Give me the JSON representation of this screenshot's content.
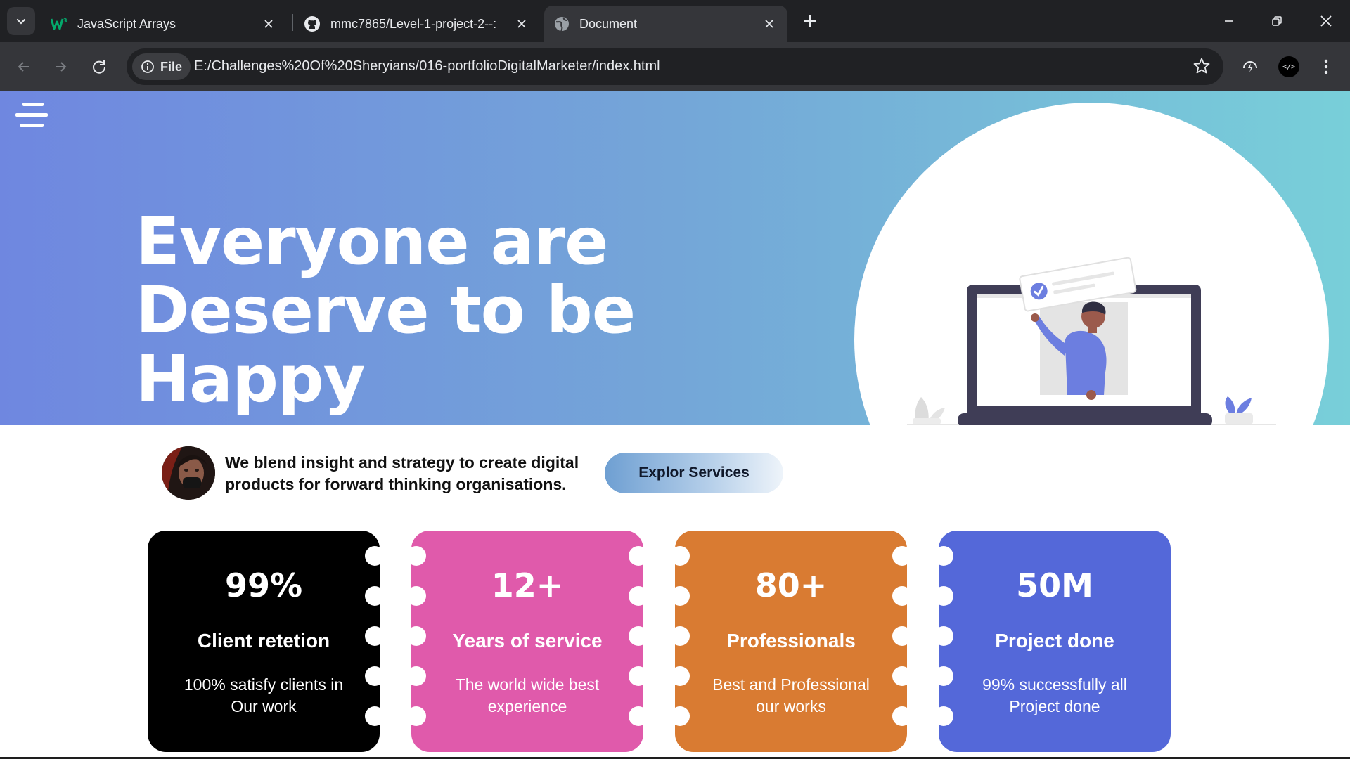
{
  "browser": {
    "tabs": [
      {
        "title": "JavaScript Arrays",
        "icon": "w3schools-icon",
        "active": false
      },
      {
        "title": "mmc7865/Level-1-project-2--:",
        "icon": "github-icon",
        "active": false
      },
      {
        "title": "Document",
        "icon": "globe-icon",
        "active": true
      }
    ],
    "omnibox": {
      "chip_label": "File",
      "url": "E:/Challenges%20Of%20Sheryians/016-portfolioDigitalMarketer/index.html"
    }
  },
  "page": {
    "hero": {
      "title_line1": "Everyone are",
      "title_line2": "Deserve to be",
      "title_line3": "Happy"
    },
    "intro": {
      "text": "We blend insight and strategy to create digital products for forward thinking organisations.",
      "button_label": "Explor Services"
    },
    "stats": [
      {
        "value": "99%",
        "label": "Client retetion",
        "description": "100% satisfy clients in Our work",
        "color": "#000000"
      },
      {
        "value": "12+",
        "label": "Years of service",
        "description": "The world wide best experience",
        "color": "#e05aab"
      },
      {
        "value": "80+",
        "label": "Professionals",
        "description": "Best and Professional our works",
        "color": "#d97b32"
      },
      {
        "value": "50M",
        "label": "Project done",
        "description": "99% successfully all Project done",
        "color": "#5468d9"
      }
    ]
  },
  "colors": {
    "hero_gradient_start": "#6f87e0",
    "hero_gradient_end": "#78cfd9",
    "browser_frame": "#202124",
    "browser_toolbar": "#35363a"
  }
}
